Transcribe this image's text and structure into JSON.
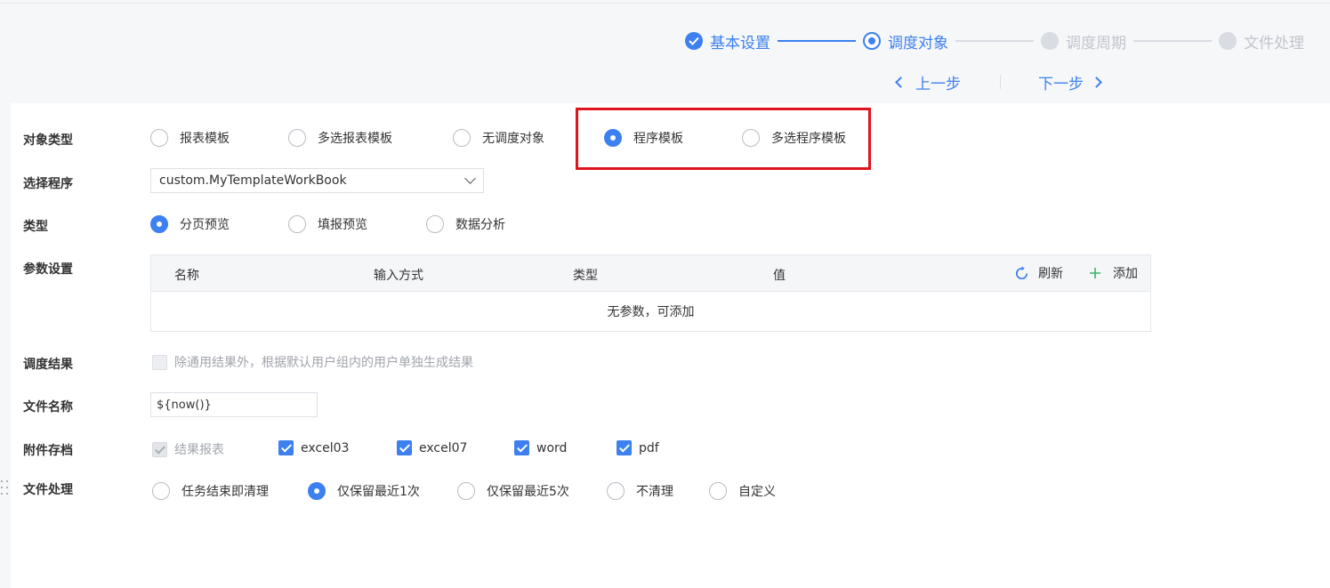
{
  "stepper": {
    "steps": [
      {
        "label": "基本设置",
        "state": "done"
      },
      {
        "label": "调度对象",
        "state": "active"
      },
      {
        "label": "调度周期",
        "state": "todo"
      },
      {
        "label": "文件处理",
        "state": "todo"
      }
    ],
    "prev_label": "上一步",
    "next_label": "下一步"
  },
  "form": {
    "object_type": {
      "label": "对象类型",
      "options": [
        "报表模板",
        "多选报表模板",
        "无调度对象",
        "程序模板",
        "多选程序模板"
      ],
      "selected": "程序模板"
    },
    "program": {
      "label": "选择程序",
      "value": "custom.MyTemplateWorkBook"
    },
    "type": {
      "label": "类型",
      "options": [
        "分页预览",
        "填报预览",
        "数据分析"
      ],
      "selected": "分页预览"
    },
    "params": {
      "label": "参数设置",
      "columns": [
        "名称",
        "输入方式",
        "类型",
        "值"
      ],
      "refresh_label": "刷新",
      "add_label": "添加",
      "empty_text": "无参数，可添加"
    },
    "schedule_result": {
      "label": "调度结果",
      "checkbox_label": "除通用结果外，根据默认用户组内的用户单独生成结果",
      "checked": false
    },
    "file_name": {
      "label": "文件名称",
      "value": "${now()}"
    },
    "attachments": {
      "label": "附件存档",
      "options": [
        {
          "label": "结果报表",
          "checked": true,
          "disabled": true
        },
        {
          "label": "excel03",
          "checked": true
        },
        {
          "label": "excel07",
          "checked": true
        },
        {
          "label": "word",
          "checked": true
        },
        {
          "label": "pdf",
          "checked": true
        }
      ]
    },
    "file_handling": {
      "label": "文件处理",
      "options": [
        "任务结束即清理",
        "仅保留最近1次",
        "仅保留最近5次",
        "不清理",
        "自定义"
      ],
      "selected": "仅保留最近1次"
    }
  },
  "colors": {
    "accent": "#3d80f0",
    "highlight": "#e0141e",
    "add_icon": "#3fb36b"
  }
}
